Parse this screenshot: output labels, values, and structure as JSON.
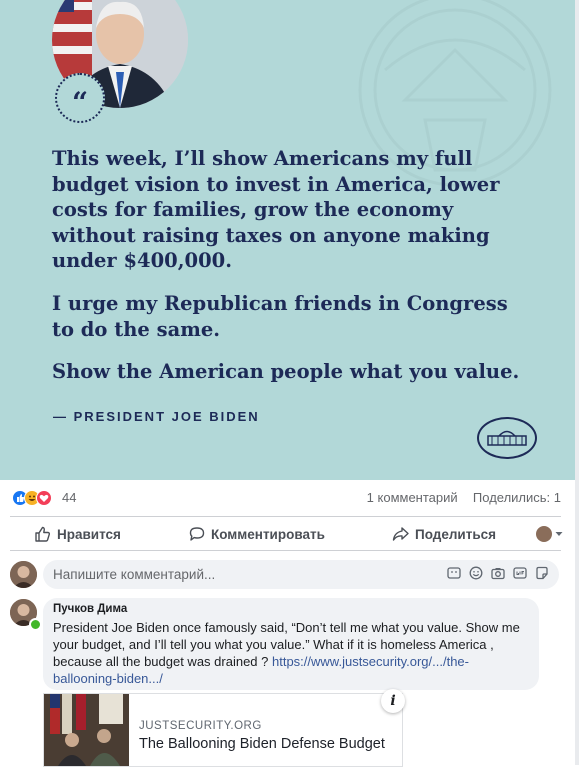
{
  "post": {
    "quote_mark": "“",
    "quote_paragraphs": [
      "This week, I’ll show Americans my full budget vision to invest in America, lower costs for families, grow the economy without raising taxes on anyone making under $400,000.",
      "I urge my Republican friends in Congress to do the same.",
      "Show the American people what you value."
    ],
    "attribution": "— PRESIDENT JOE BIDEN"
  },
  "stats": {
    "reaction_count": "44",
    "comments": "1 комментарий",
    "shares": "Поделились: 1"
  },
  "actions": {
    "like": "Нравится",
    "comment": "Комментировать",
    "share": "Поделиться"
  },
  "comment_box": {
    "placeholder": "Напишите комментарий..."
  },
  "comment": {
    "author": "Пучков Дима",
    "text": "President Joe Biden once famously said, “Don’t tell me what you value. Show me your budget, and I’ll tell you what you value.” What if it is homeless America , because all the budget was drained ? ",
    "link_text": "https://www.justsecurity.org/.../the-ballooning-biden.../"
  },
  "link_preview": {
    "domain": "JUSTSECURITY.ORG",
    "title": "The Ballooning Biden Defense Budget"
  },
  "colors": {
    "card_bg": "#b2d8d8",
    "navy": "#1d2a57",
    "link": "#385898",
    "like_blue": "#1877f2",
    "love_red": "#f33e58",
    "haha_yellow": "#f7b125"
  },
  "icons": [
    "like-reaction-icon",
    "haha-reaction-icon",
    "love-reaction-icon",
    "thumbs-up-icon",
    "comment-icon",
    "share-icon",
    "chevron-down-icon",
    "sticker-icon",
    "emoji-icon",
    "camera-icon",
    "gif-icon",
    "sticker-face-icon",
    "info-icon"
  ]
}
